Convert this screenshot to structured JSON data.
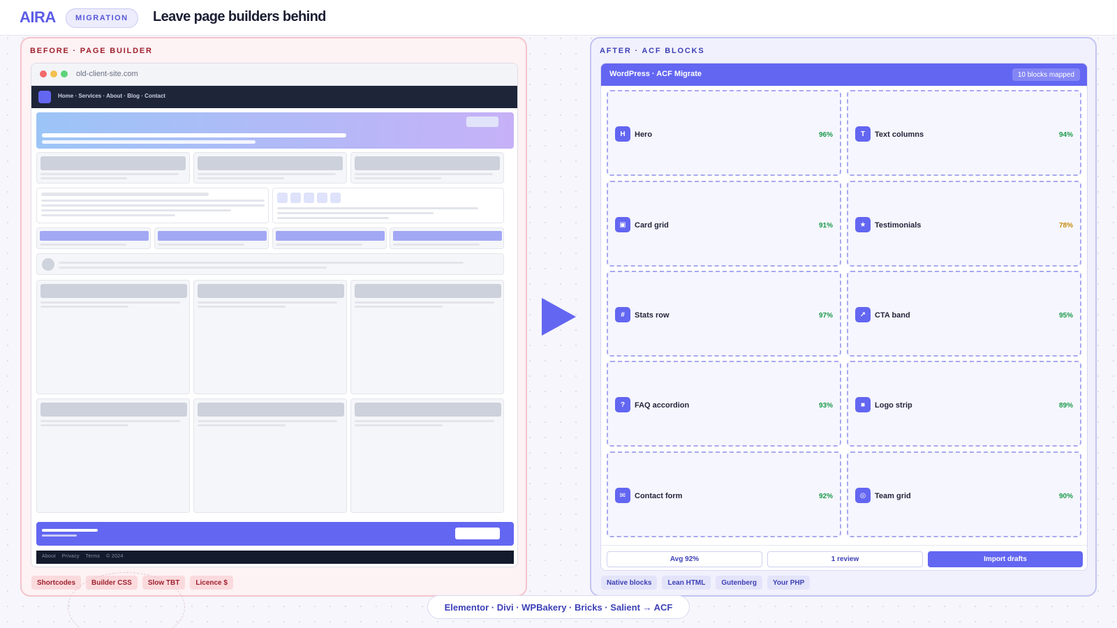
{
  "header": {
    "logo": "AIRA",
    "tag": "MIGRATION",
    "title": "Leave page builders behind"
  },
  "before": {
    "label": "BEFORE · PAGE BUILDER",
    "browser": {
      "url": "old-client-site.com",
      "nav_links": "Home · Services · About · Blog · Contact",
      "footer_links": "About    Privacy    Terms    © 2024"
    },
    "chips": [
      "Shortcodes",
      "Builder CSS",
      "Slow TBT",
      "Licence $"
    ]
  },
  "after": {
    "label": "AFTER · ACF BLOCKS",
    "app_title": "WordPress · ACF Migrate",
    "badge": "10 blocks mapped",
    "blocks": [
      {
        "icon": "H",
        "icon_name": "hero-icon",
        "name": "Hero",
        "pct": "96%"
      },
      {
        "icon": "T",
        "icon_name": "text-columns-icon",
        "name": "Text columns",
        "pct": "94%"
      },
      {
        "icon": "▣",
        "icon_name": "card-grid-icon",
        "name": "Card grid",
        "pct": "91%"
      },
      {
        "icon": "★",
        "icon_name": "star-icon",
        "name": "Testimonials",
        "pct": "78%"
      },
      {
        "icon": "#",
        "icon_name": "hash-icon",
        "name": "Stats row",
        "pct": "97%"
      },
      {
        "icon": "↗",
        "icon_name": "arrow-up-right-icon",
        "name": "CTA band",
        "pct": "95%"
      },
      {
        "icon": "?",
        "icon_name": "question-icon",
        "name": "FAQ accordion",
        "pct": "93%"
      },
      {
        "icon": "■",
        "icon_name": "square-icon",
        "name": "Logo strip",
        "pct": "89%"
      },
      {
        "icon": "✉",
        "icon_name": "mail-icon",
        "name": "Contact form",
        "pct": "92%"
      },
      {
        "icon": "◎",
        "icon_name": "team-icon",
        "name": "Team grid",
        "pct": "90%"
      }
    ],
    "footer": {
      "avg": "Avg 92%",
      "review": "1 review",
      "import": "Import drafts"
    },
    "chips": [
      "Native blocks",
      "Lean HTML",
      "Gutenberg",
      "Your PHP"
    ]
  },
  "bottom_pill": "Elementor · Divi · WPBakery · Bricks · Salient → ACF",
  "colors": {
    "accent": "#6366f1",
    "success": "#1a9a4a",
    "warning": "#c78a0a",
    "danger": "#a01f2c"
  }
}
